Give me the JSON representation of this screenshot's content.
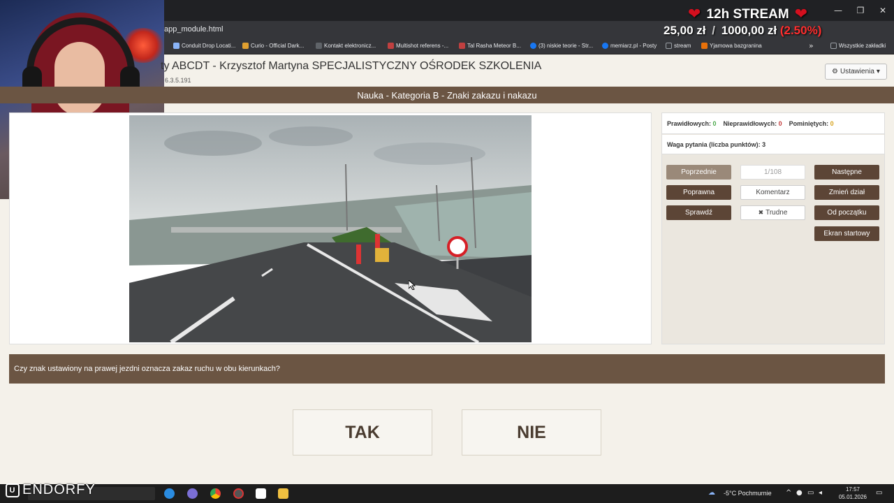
{
  "browser": {
    "url": "app_module.html",
    "window_controls": [
      "—",
      "❐",
      "✕"
    ],
    "bookmarks": [
      {
        "label": "Conduit Drop Locati...",
        "color": "#8ab4f8"
      },
      {
        "label": "Curio - Official Dark...",
        "color": "#e0a030"
      },
      {
        "label": "Kontakt elektronicz...",
        "color": "#5f6368"
      },
      {
        "label": "Multishot referens -...",
        "color": "#c04040"
      },
      {
        "label": "Tal Rasha Meteor B...",
        "color": "#c04040"
      },
      {
        "label": "(3) niskie teorie - Str...",
        "color": "#1877f2"
      },
      {
        "label": "memiarz.pl - Posty",
        "color": "#1877f2"
      },
      {
        "label": "stream",
        "color": "#9aa0a6"
      },
      {
        "label": "Yjamowa bazgranina",
        "color": "#e8710a"
      }
    ],
    "bookmarks_more": "»",
    "all_bookmarks": "Wszystkie zakładki"
  },
  "overlay": {
    "title": "12h STREAM",
    "heart": "❤",
    "current": "25,00 zł",
    "slash": "/",
    "goal": "1000,00 zł",
    "percent": "(2.50%)"
  },
  "app": {
    "title": "ty ABCDT - Krzysztof Martyna SPECJALISTYCZNY OŚRODEK SZKOLENIA",
    "version": "6.3.5.191",
    "settings_icon": "⚙",
    "settings_label": "Ustawienia",
    "settings_caret": "▾",
    "category": "Nauka - Kategoria B - Znaki zakazu i nakazu"
  },
  "stats": {
    "correct_label": "Prawidłowych:",
    "correct_value": "0",
    "incorrect_label": "Nieprawidłowych:",
    "incorrect_value": "0",
    "skipped_label": "Pominiętych:",
    "skipped_value": "0",
    "weight": "Waga pytania (liczba punktów): 3"
  },
  "controls": {
    "previous": "Poprzednie",
    "page": "1/108",
    "next": "Następne",
    "correct": "Poprawna",
    "comment": "Komentarz",
    "change_section": "Zmień dział",
    "check": "Sprawdź",
    "difficult_icon": "✖",
    "difficult": "Trudne",
    "from_start": "Od początku",
    "start_screen": "Ekran startowy"
  },
  "question": {
    "text": "Czy znak ustawiony na prawej jezdni oznacza zakaz ruchu w obu kierunkach?",
    "answer_yes": "TAK",
    "answer_no": "NIE"
  },
  "taskbar": {
    "brand": "ENDORFY",
    "brand_mark": "U",
    "weather": "-5°C  Pochmurnie",
    "tray_symbols": "^",
    "time": "17:57",
    "date": "05.01.2026",
    "notifications_icon": "▭"
  },
  "colors": {
    "accent_brown": "#6b5543",
    "button_dark": "#5c4536",
    "stat_correct": "#4aa84a",
    "stat_incorrect": "#c43c3c",
    "stat_skipped": "#d6a21e"
  }
}
